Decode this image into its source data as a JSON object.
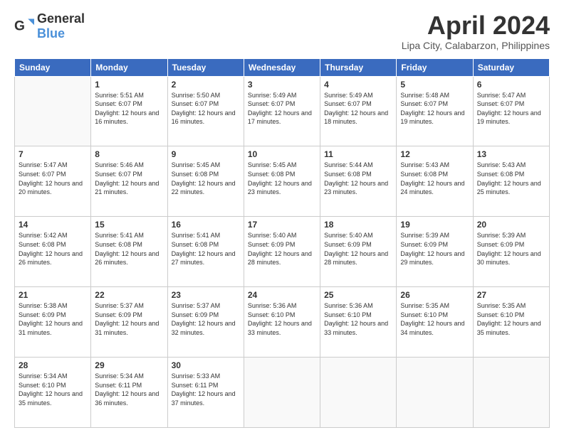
{
  "logo": {
    "general": "General",
    "blue": "Blue"
  },
  "title": "April 2024",
  "location": "Lipa City, Calabarzon, Philippines",
  "headers": [
    "Sunday",
    "Monday",
    "Tuesday",
    "Wednesday",
    "Thursday",
    "Friday",
    "Saturday"
  ],
  "weeks": [
    [
      {
        "day": "",
        "sunrise": "",
        "sunset": "",
        "daylight": ""
      },
      {
        "day": "1",
        "sunrise": "Sunrise: 5:51 AM",
        "sunset": "Sunset: 6:07 PM",
        "daylight": "Daylight: 12 hours and 16 minutes."
      },
      {
        "day": "2",
        "sunrise": "Sunrise: 5:50 AM",
        "sunset": "Sunset: 6:07 PM",
        "daylight": "Daylight: 12 hours and 16 minutes."
      },
      {
        "day": "3",
        "sunrise": "Sunrise: 5:49 AM",
        "sunset": "Sunset: 6:07 PM",
        "daylight": "Daylight: 12 hours and 17 minutes."
      },
      {
        "day": "4",
        "sunrise": "Sunrise: 5:49 AM",
        "sunset": "Sunset: 6:07 PM",
        "daylight": "Daylight: 12 hours and 18 minutes."
      },
      {
        "day": "5",
        "sunrise": "Sunrise: 5:48 AM",
        "sunset": "Sunset: 6:07 PM",
        "daylight": "Daylight: 12 hours and 19 minutes."
      },
      {
        "day": "6",
        "sunrise": "Sunrise: 5:47 AM",
        "sunset": "Sunset: 6:07 PM",
        "daylight": "Daylight: 12 hours and 19 minutes."
      }
    ],
    [
      {
        "day": "7",
        "sunrise": "Sunrise: 5:47 AM",
        "sunset": "Sunset: 6:07 PM",
        "daylight": "Daylight: 12 hours and 20 minutes."
      },
      {
        "day": "8",
        "sunrise": "Sunrise: 5:46 AM",
        "sunset": "Sunset: 6:07 PM",
        "daylight": "Daylight: 12 hours and 21 minutes."
      },
      {
        "day": "9",
        "sunrise": "Sunrise: 5:45 AM",
        "sunset": "Sunset: 6:08 PM",
        "daylight": "Daylight: 12 hours and 22 minutes."
      },
      {
        "day": "10",
        "sunrise": "Sunrise: 5:45 AM",
        "sunset": "Sunset: 6:08 PM",
        "daylight": "Daylight: 12 hours and 23 minutes."
      },
      {
        "day": "11",
        "sunrise": "Sunrise: 5:44 AM",
        "sunset": "Sunset: 6:08 PM",
        "daylight": "Daylight: 12 hours and 23 minutes."
      },
      {
        "day": "12",
        "sunrise": "Sunrise: 5:43 AM",
        "sunset": "Sunset: 6:08 PM",
        "daylight": "Daylight: 12 hours and 24 minutes."
      },
      {
        "day": "13",
        "sunrise": "Sunrise: 5:43 AM",
        "sunset": "Sunset: 6:08 PM",
        "daylight": "Daylight: 12 hours and 25 minutes."
      }
    ],
    [
      {
        "day": "14",
        "sunrise": "Sunrise: 5:42 AM",
        "sunset": "Sunset: 6:08 PM",
        "daylight": "Daylight: 12 hours and 26 minutes."
      },
      {
        "day": "15",
        "sunrise": "Sunrise: 5:41 AM",
        "sunset": "Sunset: 6:08 PM",
        "daylight": "Daylight: 12 hours and 26 minutes."
      },
      {
        "day": "16",
        "sunrise": "Sunrise: 5:41 AM",
        "sunset": "Sunset: 6:08 PM",
        "daylight": "Daylight: 12 hours and 27 minutes."
      },
      {
        "day": "17",
        "sunrise": "Sunrise: 5:40 AM",
        "sunset": "Sunset: 6:09 PM",
        "daylight": "Daylight: 12 hours and 28 minutes."
      },
      {
        "day": "18",
        "sunrise": "Sunrise: 5:40 AM",
        "sunset": "Sunset: 6:09 PM",
        "daylight": "Daylight: 12 hours and 28 minutes."
      },
      {
        "day": "19",
        "sunrise": "Sunrise: 5:39 AM",
        "sunset": "Sunset: 6:09 PM",
        "daylight": "Daylight: 12 hours and 29 minutes."
      },
      {
        "day": "20",
        "sunrise": "Sunrise: 5:39 AM",
        "sunset": "Sunset: 6:09 PM",
        "daylight": "Daylight: 12 hours and 30 minutes."
      }
    ],
    [
      {
        "day": "21",
        "sunrise": "Sunrise: 5:38 AM",
        "sunset": "Sunset: 6:09 PM",
        "daylight": "Daylight: 12 hours and 31 minutes."
      },
      {
        "day": "22",
        "sunrise": "Sunrise: 5:37 AM",
        "sunset": "Sunset: 6:09 PM",
        "daylight": "Daylight: 12 hours and 31 minutes."
      },
      {
        "day": "23",
        "sunrise": "Sunrise: 5:37 AM",
        "sunset": "Sunset: 6:09 PM",
        "daylight": "Daylight: 12 hours and 32 minutes."
      },
      {
        "day": "24",
        "sunrise": "Sunrise: 5:36 AM",
        "sunset": "Sunset: 6:10 PM",
        "daylight": "Daylight: 12 hours and 33 minutes."
      },
      {
        "day": "25",
        "sunrise": "Sunrise: 5:36 AM",
        "sunset": "Sunset: 6:10 PM",
        "daylight": "Daylight: 12 hours and 33 minutes."
      },
      {
        "day": "26",
        "sunrise": "Sunrise: 5:35 AM",
        "sunset": "Sunset: 6:10 PM",
        "daylight": "Daylight: 12 hours and 34 minutes."
      },
      {
        "day": "27",
        "sunrise": "Sunrise: 5:35 AM",
        "sunset": "Sunset: 6:10 PM",
        "daylight": "Daylight: 12 hours and 35 minutes."
      }
    ],
    [
      {
        "day": "28",
        "sunrise": "Sunrise: 5:34 AM",
        "sunset": "Sunset: 6:10 PM",
        "daylight": "Daylight: 12 hours and 35 minutes."
      },
      {
        "day": "29",
        "sunrise": "Sunrise: 5:34 AM",
        "sunset": "Sunset: 6:11 PM",
        "daylight": "Daylight: 12 hours and 36 minutes."
      },
      {
        "day": "30",
        "sunrise": "Sunrise: 5:33 AM",
        "sunset": "Sunset: 6:11 PM",
        "daylight": "Daylight: 12 hours and 37 minutes."
      },
      {
        "day": "",
        "sunrise": "",
        "sunset": "",
        "daylight": ""
      },
      {
        "day": "",
        "sunrise": "",
        "sunset": "",
        "daylight": ""
      },
      {
        "day": "",
        "sunrise": "",
        "sunset": "",
        "daylight": ""
      },
      {
        "day": "",
        "sunrise": "",
        "sunset": "",
        "daylight": ""
      }
    ]
  ]
}
